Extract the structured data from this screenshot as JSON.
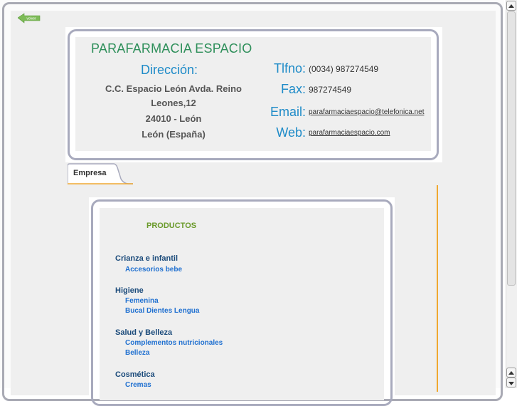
{
  "nav": {
    "back_label": "volver"
  },
  "header": {
    "company": "PARAFARMACIA ESPACIO",
    "address_title": "Dirección:",
    "address_lines": [
      "C.C. Espacio León Avda. Reino",
      "Leones,12",
      "24010 - León",
      "León (España)"
    ],
    "phone_label": "Tlfno:",
    "phone": "(0034) 987274549",
    "fax_label": "Fax:",
    "fax": "987274549",
    "email_label": "Email:",
    "email": "parafarmaciaespacio@telefonica.net",
    "web_label": "Web:",
    "web": "parafarmaciaespacio.com"
  },
  "tabs": [
    {
      "label": "Empresa"
    }
  ],
  "products": {
    "title": "PRODUCTOS",
    "categories": [
      {
        "name": "Crianza e infantil",
        "items": [
          "Accesorios bebe"
        ]
      },
      {
        "name": "Higiene",
        "items": [
          "Femenina",
          "Bucal Dientes Lengua"
        ]
      },
      {
        "name": "Salud y Belleza",
        "items": [
          "Complementos nutricionales",
          "Belleza"
        ]
      },
      {
        "name": "Cosmética",
        "items": [
          "Cremas"
        ]
      }
    ]
  },
  "colors": {
    "accent_blue": "#1e8bc8",
    "company_green": "#2e8f5a",
    "tab_orange": "#f0a830"
  }
}
